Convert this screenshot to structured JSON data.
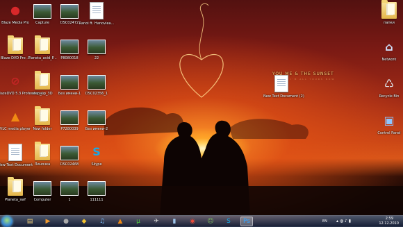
{
  "desktop": {
    "icons": [
      {
        "label": "Blaze Media Pro",
        "type": "glyph",
        "glyph": "●",
        "color": "#d8282a",
        "col": 0,
        "row": 0
      },
      {
        "label": "Capture",
        "type": "photo",
        "col": 1,
        "row": 0
      },
      {
        "label": "DSC02472",
        "type": "photo",
        "col": 2,
        "row": 0
      },
      {
        "label": "Ranoi ft. Hanoviea...",
        "type": "doc",
        "col": 3,
        "row": 0
      },
      {
        "label": "Blaze DVD Pro ...",
        "type": "folder",
        "col": 0,
        "row": 1
      },
      {
        "label": "Planeta_avid_P...",
        "type": "folder",
        "col": 1,
        "row": 1
      },
      {
        "label": "P8080018",
        "type": "photo",
        "col": 2,
        "row": 1
      },
      {
        "label": "22",
        "type": "photo",
        "col": 3,
        "row": 1
      },
      {
        "label": "BlazeDVD 5.3 Professional",
        "type": "glyph",
        "glyph": "⊘",
        "color": "#c42525",
        "col": 0,
        "row": 2
      },
      {
        "label": "step_up_3D",
        "type": "folder",
        "col": 1,
        "row": 2
      },
      {
        "label": "Без имени-1",
        "type": "photo",
        "col": 2,
        "row": 2
      },
      {
        "label": "DSC02356_1",
        "type": "photo",
        "col": 3,
        "row": 2
      },
      {
        "label": "VLC media player",
        "type": "glyph",
        "glyph": "▲",
        "color": "#f08a14",
        "col": 0,
        "row": 3
      },
      {
        "label": "New folder",
        "type": "folder",
        "col": 1,
        "row": 3
      },
      {
        "label": "P7280039",
        "type": "photo",
        "col": 2,
        "row": 3
      },
      {
        "label": "Без имени-2",
        "type": "photo",
        "col": 3,
        "row": 3
      },
      {
        "label": "New Text Document",
        "type": "doc",
        "col": 0,
        "row": 4
      },
      {
        "label": "Линочка",
        "type": "folder",
        "col": 1,
        "row": 4
      },
      {
        "label": "DSC02468",
        "type": "photo",
        "col": 2,
        "row": 4
      },
      {
        "label": "Skype",
        "type": "glyph",
        "glyph": "S",
        "color": "#18a9e6",
        "col": 3,
        "row": 4
      },
      {
        "label": "Planeta_swf",
        "type": "folder",
        "col": 0,
        "row": 5
      },
      {
        "label": "Computer",
        "type": "photo",
        "col": 1,
        "row": 5
      },
      {
        "label": "1",
        "type": "photo",
        "col": 2,
        "row": 5
      },
      {
        "label": "111111",
        "type": "photo",
        "col": 3,
        "row": 5
      }
    ],
    "right_icons": [
      {
        "label": "папки",
        "type": "folder"
      },
      {
        "label": "Network",
        "type": "glyph",
        "glyph": "⌂",
        "color": "#cfe3ff"
      },
      {
        "label": "Recycle Bin",
        "type": "glyph",
        "glyph": "♺",
        "color": "#dfe8f0"
      },
      {
        "label": "Control Panel",
        "type": "glyph",
        "glyph": "▣",
        "color": "#8ec6ff"
      }
    ],
    "center_icon": {
      "label": "New Text Document (2)",
      "type": "doc"
    },
    "wallpaper_text": "YOU ME & THE SUNSET",
    "wallpaper_subtext": "I'M ALL YOURS NOW"
  },
  "taskbar": {
    "apps": [
      {
        "name": "explorer",
        "glyph": "▤",
        "color": "#f4d27a"
      },
      {
        "name": "media-player",
        "glyph": "▶",
        "color": "#f09a30"
      },
      {
        "name": "app-1",
        "glyph": "●",
        "color": "#aaaaaa"
      },
      {
        "name": "app-2",
        "glyph": "◆",
        "color": "#f2c230"
      },
      {
        "name": "itunes",
        "glyph": "♫",
        "color": "#7fc2ff"
      },
      {
        "name": "vlc",
        "glyph": "▲",
        "color": "#f08a14"
      },
      {
        "name": "utorrent",
        "glyph": "μ",
        "color": "#4ec240"
      },
      {
        "name": "app-3",
        "glyph": "✈",
        "color": "#cfcfcf"
      },
      {
        "name": "app-4",
        "glyph": "▮",
        "color": "#9ec5ea"
      },
      {
        "name": "chrome",
        "glyph": "◉",
        "color": "#e84b3a"
      },
      {
        "name": "app-5",
        "glyph": "☺",
        "color": "#80c060"
      },
      {
        "name": "skype",
        "glyph": "S",
        "color": "#18a9e6"
      },
      {
        "name": "photoshop",
        "glyph": "Ps",
        "color": "#33a3ff"
      }
    ],
    "language": "EN",
    "time": "2:59",
    "date": "12.12.2010"
  }
}
